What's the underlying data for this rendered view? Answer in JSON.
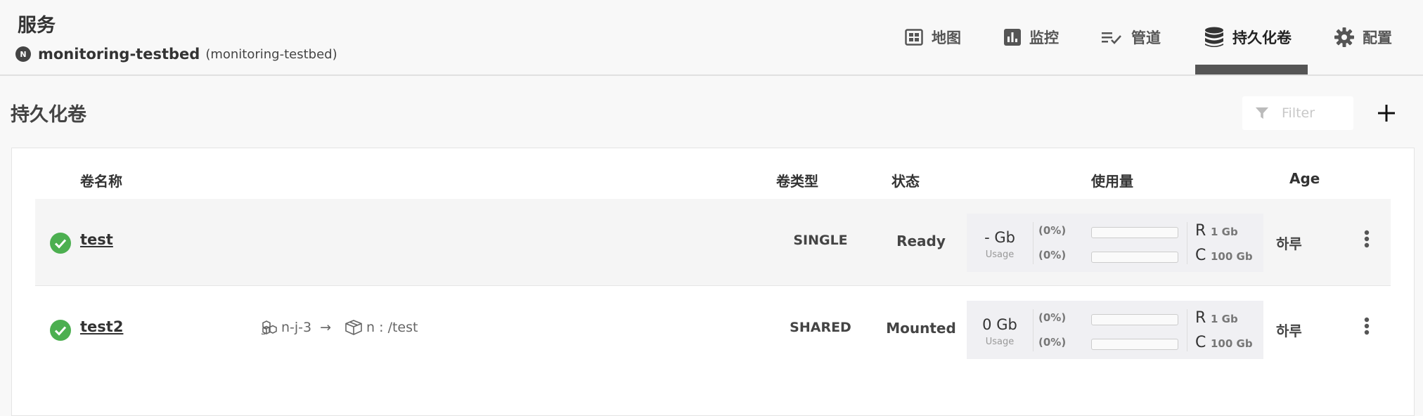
{
  "header": {
    "service_title": "服务",
    "namespace": {
      "name": "monitoring-testbed",
      "subtitle": "(monitoring-testbed)"
    }
  },
  "nav": {
    "tabs": [
      {
        "label": "地图",
        "icon": "map-grid-icon",
        "active": false
      },
      {
        "label": "监控",
        "icon": "bar-chart-icon",
        "active": false
      },
      {
        "label": "管道",
        "icon": "pipeline-list-icon",
        "active": false
      },
      {
        "label": "持久化卷",
        "icon": "database-icon",
        "active": true
      },
      {
        "label": "配置",
        "icon": "gear-icon",
        "active": false
      }
    ]
  },
  "page": {
    "title": "持久化卷",
    "filter_placeholder": "Filter",
    "add_label": "+"
  },
  "table": {
    "columns": {
      "name": "卷名称",
      "type": "卷类型",
      "state": "状态",
      "usage": "使用量",
      "age": "Age"
    },
    "rows": [
      {
        "status": "ok",
        "name": "test",
        "mount": null,
        "type": "SINGLE",
        "state": "Ready",
        "usage": {
          "value": "- Gb",
          "label": "Usage",
          "request_pct": "(0%)",
          "request_fraction": 0,
          "capacity_pct": "(0%)",
          "capacity_fraction": 0,
          "request_letter": "R",
          "request_value": "1 Gb",
          "capacity_letter": "C",
          "capacity_value": "100 Gb"
        },
        "age": "하루"
      },
      {
        "status": "ok",
        "name": "test2",
        "mount": {
          "node": "n-j-3",
          "arrow": "→",
          "path": "n : /test"
        },
        "type": "SHARED",
        "state": "Mounted",
        "usage": {
          "value": "0 Gb",
          "label": "Usage",
          "request_pct": "(0%)",
          "request_fraction": 0,
          "capacity_pct": "(0%)",
          "capacity_fraction": 0,
          "request_letter": "R",
          "request_value": "1 Gb",
          "capacity_letter": "C",
          "capacity_value": "100 Gb"
        },
        "age": "하루"
      }
    ]
  },
  "colors": {
    "accent": "#555555",
    "ok_green": "#4caf50",
    "bar_fill": "#7aa7d8"
  }
}
